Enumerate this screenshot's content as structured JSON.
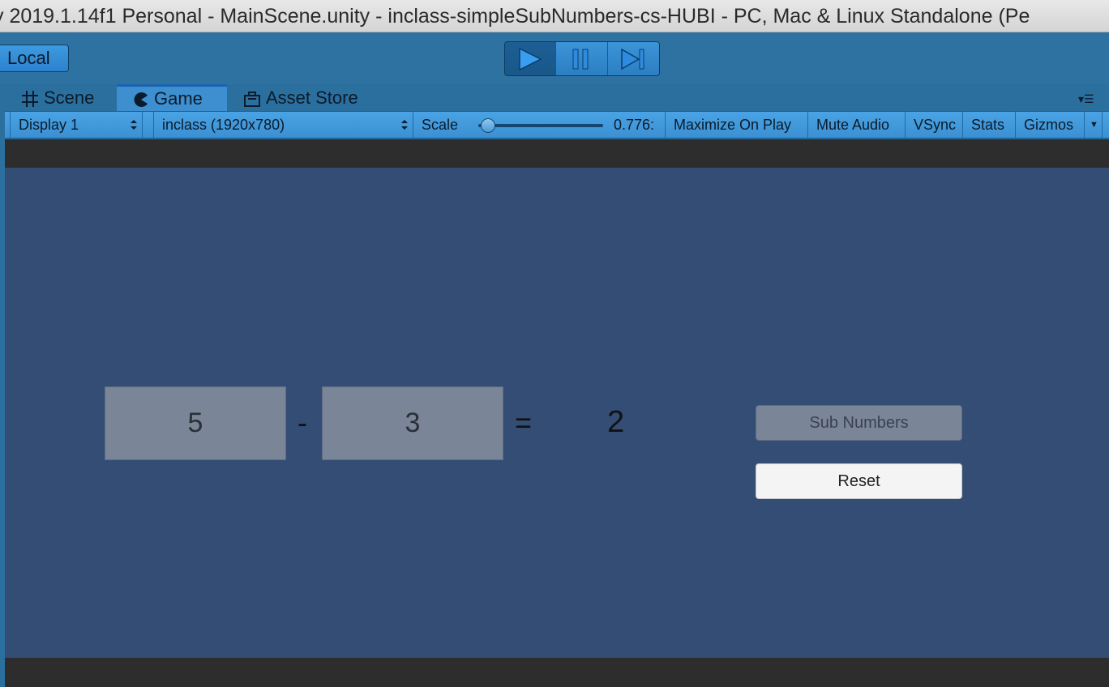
{
  "window": {
    "title": "y 2019.1.14f1 Personal - MainScene.unity - inclass-simpleSubNumbers-cs-HUBI - PC, Mac & Linux Standalone (Pe"
  },
  "toolbar": {
    "local_label": "Local",
    "play_controls": [
      "play-icon",
      "pause-icon",
      "step-icon"
    ]
  },
  "tabs": [
    {
      "label": "Scene",
      "icon": "grid-icon"
    },
    {
      "label": "Game",
      "icon": "pacman-icon",
      "active": true
    },
    {
      "label": "Asset Store",
      "icon": "store-icon"
    }
  ],
  "game_controls": {
    "display": "Display 1",
    "resolution": "inclass (1920x780)",
    "scale_label": "Scale",
    "scale_value": "0.776:",
    "scale_fraction": 0.05,
    "maximize": "Maximize On Play",
    "mute": "Mute Audio",
    "vsync": "VSync",
    "stats": "Stats",
    "gizmos": "Gizmos"
  },
  "game": {
    "number1": "5",
    "operator": "-",
    "number2": "3",
    "equals": "=",
    "result": "2",
    "sub_button": "Sub Numbers",
    "reset_button": "Reset"
  },
  "colors": {
    "editor_blue": "#2b6f9e",
    "game_background": "#344d75",
    "input_box": "#7a8598"
  }
}
